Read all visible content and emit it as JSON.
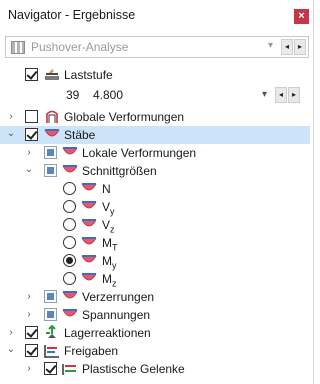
{
  "window": {
    "title": "Navigator - Ergebnisse",
    "close_symbol": "×"
  },
  "loadcase": {
    "selected": "Pushover-Analyse",
    "caret": "▾",
    "prev": "◂",
    "next": "▸"
  },
  "loadstep": {
    "label": "Laststufe",
    "number": "39",
    "value": "4.800",
    "caret": "▾",
    "prev": "◂",
    "next": "▸"
  },
  "tree": {
    "global_deformations": "Globale Verformungen",
    "members": "Stäbe",
    "local_deformations": "Lokale Verformungen",
    "internal_forces": "Schnittgrößen",
    "forces": [
      {
        "name": "N",
        "sub": ""
      },
      {
        "name": "V",
        "sub": "y"
      },
      {
        "name": "V",
        "sub": "z"
      },
      {
        "name": "M",
        "sub": "T"
      },
      {
        "name": "M",
        "sub": "y"
      },
      {
        "name": "M",
        "sub": "z"
      }
    ],
    "strains": "Verzerrungen",
    "stresses": "Spannungen",
    "support_reactions": "Lagerreaktionen",
    "releases": "Freigaben",
    "plastic_hinges": "Plastische Gelenke"
  },
  "colors": {
    "accent_red": "#c7354a",
    "selection": "#cde3f7",
    "member_blue": "#3a6fc4"
  }
}
